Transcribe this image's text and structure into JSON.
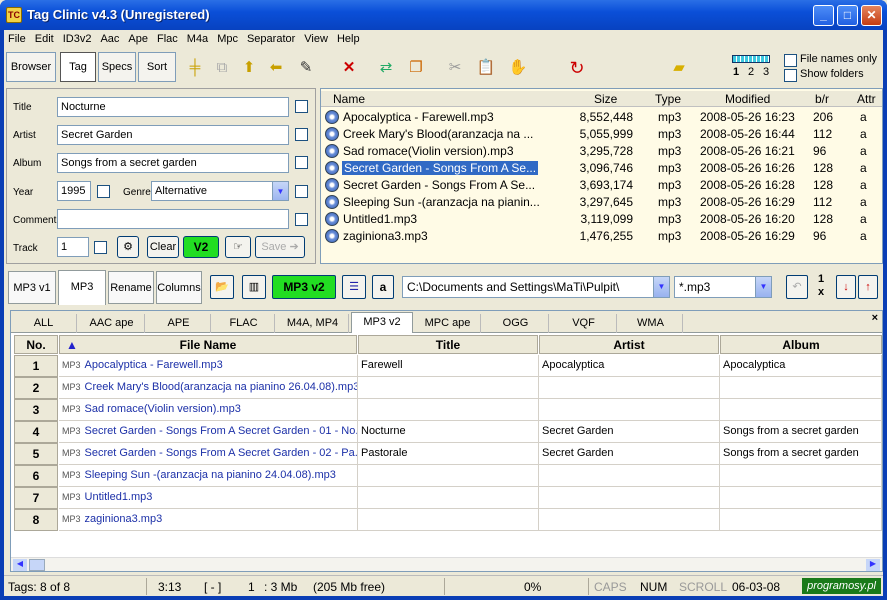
{
  "window": {
    "title": "Tag Clinic v4.3 (Unregistered)"
  },
  "menu": [
    "File",
    "Edit",
    "ID3v2",
    "Aac",
    "Ape",
    "Flac",
    "M4a",
    "Mpc",
    "Separator",
    "View",
    "Help"
  ],
  "toolbar": {
    "browser": "Browser",
    "tag": "Tag",
    "specs": "Specs",
    "sort": "Sort",
    "levels": [
      "1",
      "2",
      "3"
    ],
    "file_names_only": "File names only",
    "show_folders": "Show folders"
  },
  "tagform": {
    "title_label": "Title",
    "title_value": "Nocturne",
    "artist_label": "Artist",
    "artist_value": "Secret Garden",
    "album_label": "Album",
    "album_value": "Songs from a secret garden",
    "year_label": "Year",
    "year_value": "1995",
    "genre_label": "Genre",
    "genre_value": "Alternative",
    "comment_label": "Comment",
    "comment_value": "",
    "track_label": "Track",
    "track_value": "1",
    "clear": "Clear",
    "v2": "V2",
    "save": "Save"
  },
  "filelist": {
    "headers": {
      "name": "Name",
      "size": "Size",
      "type": "Type",
      "modified": "Modified",
      "br": "b/r",
      "attr": "Attr"
    },
    "rows": [
      {
        "name": "Apocalyptica - Farewell.mp3",
        "size": "8,552,448",
        "type": "mp3",
        "modified": "2008-05-26 16:23",
        "br": "206",
        "attr": "a"
      },
      {
        "name": "Creek Mary's Blood(aranzacja na ...",
        "size": "5,055,999",
        "type": "mp3",
        "modified": "2008-05-26 16:44",
        "br": "112",
        "attr": "a"
      },
      {
        "name": "Sad romace(Violin version).mp3",
        "size": "3,295,728",
        "type": "mp3",
        "modified": "2008-05-26 16:21",
        "br": "96",
        "attr": "a"
      },
      {
        "name": "Secret Garden - Songs From A Se...",
        "size": "3,096,746",
        "type": "mp3",
        "modified": "2008-05-26 16:26",
        "br": "128",
        "attr": "a"
      },
      {
        "name": "Secret Garden - Songs From A Se...",
        "size": "3,693,174",
        "type": "mp3",
        "modified": "2008-05-26 16:28",
        "br": "128",
        "attr": "a"
      },
      {
        "name": "Sleeping Sun -(aranzacja na pianin...",
        "size": "3,297,645",
        "type": "mp3",
        "modified": "2008-05-26 16:29",
        "br": "112",
        "attr": "a"
      },
      {
        "name": "Untitled1.mp3",
        "size": "3,119,099",
        "type": "mp3",
        "modified": "2008-05-26 16:20",
        "br": "128",
        "attr": "a"
      },
      {
        "name": "zaginiona3.mp3",
        "size": "1,476,255",
        "type": "mp3",
        "modified": "2008-05-26 16:29",
        "br": "96",
        "attr": "a"
      }
    ]
  },
  "modetabs": {
    "mp3v1": "MP3 v1",
    "mp3": "MP3",
    "rename": "Rename",
    "columns": "Columns"
  },
  "bar2": {
    "mp3v2": "MP3 v2",
    "a": "a",
    "path": "C:\\Documents and Settings\\MaTi\\Pulpit\\",
    "filter": "*.mp3",
    "one": "1",
    "x": "x"
  },
  "formattabs": [
    "ALL",
    "AAC ape",
    "APE",
    "FLAC",
    "M4A, MP4",
    "MP3 v2",
    "MPC ape",
    "OGG",
    "VQF",
    "WMA"
  ],
  "grid": {
    "headers": {
      "no": "No.",
      "filename": "File Name",
      "title": "Title",
      "artist": "Artist",
      "album": "Album"
    },
    "type_tag": "MP3",
    "rows": [
      {
        "no": "1",
        "filename": "Apocalyptica - Farewell.mp3",
        "title": "Farewell",
        "artist": "Apocalyptica",
        "album": "Apocalyptica"
      },
      {
        "no": "2",
        "filename": "Creek Mary's Blood(aranzacja na pianino 26.04.08).mp3",
        "title": "",
        "artist": "",
        "album": ""
      },
      {
        "no": "3",
        "filename": "Sad romace(Violin version).mp3",
        "title": "",
        "artist": "",
        "album": ""
      },
      {
        "no": "4",
        "filename": "Secret Garden - Songs From A Secret Garden - 01 - No...",
        "title": "Nocturne",
        "artist": "Secret Garden",
        "album": "Songs from a secret garden"
      },
      {
        "no": "5",
        "filename": "Secret Garden - Songs From A Secret Garden - 02 - Pa...",
        "title": "Pastorale",
        "artist": "Secret Garden",
        "album": "Songs from a secret garden"
      },
      {
        "no": "6",
        "filename": "Sleeping Sun -(aranzacja na pianino 24.04.08).mp3",
        "title": "",
        "artist": "",
        "album": ""
      },
      {
        "no": "7",
        "filename": "Untitled1.mp3",
        "title": "",
        "artist": "",
        "album": ""
      },
      {
        "no": "8",
        "filename": "zaginiona3.mp3",
        "title": "",
        "artist": "",
        "album": ""
      }
    ]
  },
  "status": {
    "tags": "Tags: 8 of 8",
    "time": "3:13",
    "bracket": "[ - ]",
    "one": "1",
    "size": ": 3 Mb",
    "free": "(205 Mb free)",
    "pct": "0%",
    "caps": "CAPS",
    "num": "NUM",
    "scroll": "SCROLL",
    "date": "06-03-08"
  },
  "watermark": "programosy.pl"
}
